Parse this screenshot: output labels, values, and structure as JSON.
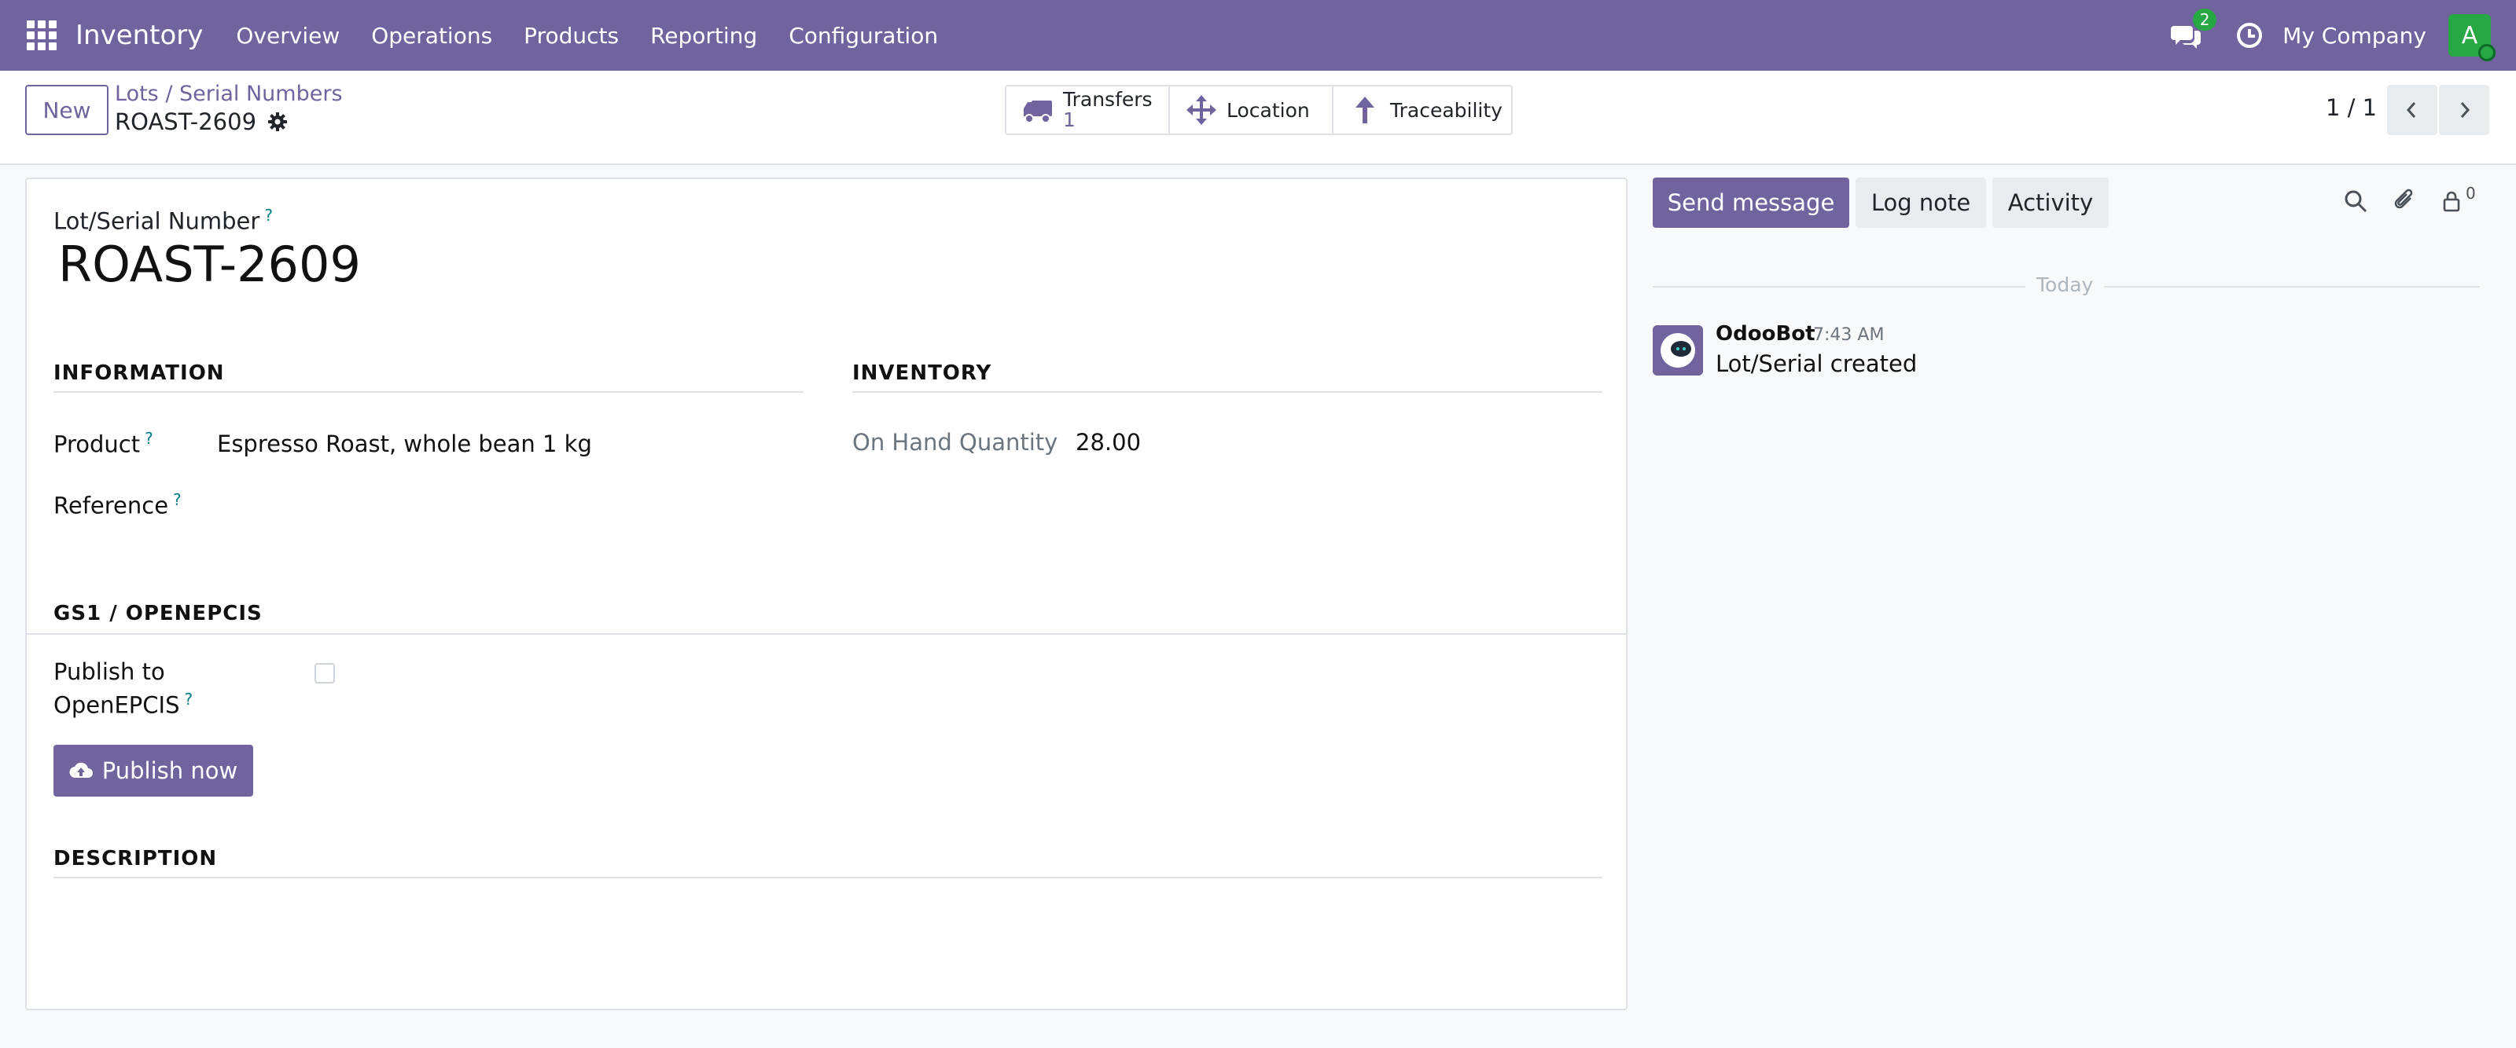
{
  "topbar": {
    "app_name": "Inventory",
    "menu": [
      "Overview",
      "Operations",
      "Products",
      "Reporting",
      "Configuration"
    ],
    "chat_badge": "2",
    "company": "My Company",
    "avatar_letter": "A"
  },
  "control": {
    "new_label": "New",
    "breadcrumb": "Lots / Serial Numbers",
    "record_name": "ROAST-2609",
    "smart_buttons": {
      "transfers_label": "Transfers",
      "transfers_count": "1",
      "location_label": "Location",
      "traceability_label": "Traceability"
    },
    "pager": "1 / 1"
  },
  "form": {
    "lot_label": "Lot/Serial Number",
    "help_mark": "?",
    "lot_name": "ROAST-2609",
    "information_title": "INFORMATION",
    "product_label": "Product",
    "product_value": "Espresso Roast, whole bean 1 kg",
    "reference_label": "Reference",
    "inventory_title": "INVENTORY",
    "on_hand_label": "On Hand Quantity",
    "on_hand_value": "28.00",
    "gs1_title": "GS1 / OPENEPCIS",
    "publish_label_line1": "Publish to",
    "publish_label_line2": "OpenEPCIS",
    "publish_checked": false,
    "publish_now_label": "Publish now",
    "description_title": "DESCRIPTION"
  },
  "chatter": {
    "send_message": "Send message",
    "log_note": "Log note",
    "activity": "Activity",
    "followers_count": "0",
    "today": "Today",
    "messages": [
      {
        "author": "OdooBot",
        "time": "7:43 AM",
        "body": "Lot/Serial created"
      }
    ]
  },
  "colors": {
    "brand": "#71639e",
    "success": "#28a745",
    "help": "#017e84"
  }
}
